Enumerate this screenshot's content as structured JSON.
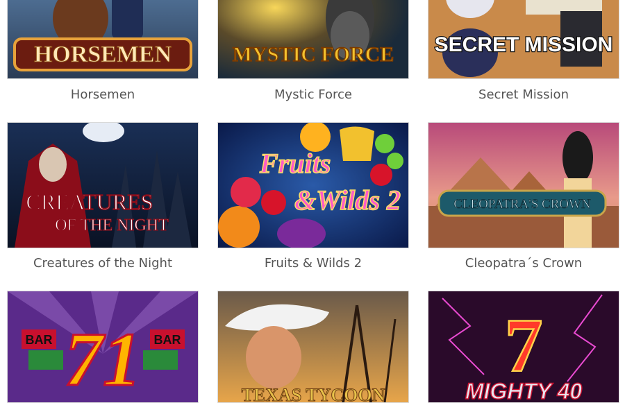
{
  "games": [
    {
      "id": "horsemen",
      "title": "Horsemen",
      "logo_text": "HORSEMEN",
      "icon": "horsemen-thumbnail",
      "accent": "#e8a23a"
    },
    {
      "id": "mystic-force",
      "title": "Mystic Force",
      "logo_text": "MYSTIC FORCE",
      "icon": "mystic-force-thumbnail",
      "accent": "#f2c12e"
    },
    {
      "id": "secret-mission",
      "title": "Secret Mission",
      "logo_text": "SECRET MISSION",
      "icon": "secret-mission-thumbnail",
      "accent": "#ffffff"
    },
    {
      "id": "creatures-night",
      "title": "Creatures of the Night",
      "logo_line1": "CREATURES",
      "logo_line2": "OF THE NIGHT",
      "icon": "creatures-thumbnail",
      "accent": "#c8102e"
    },
    {
      "id": "fruits-wilds-2",
      "title": "Fruits & Wilds 2",
      "logo_line1": "Fruits",
      "logo_line2": "&Wilds 2",
      "icon": "fruits-wilds-thumbnail",
      "accent": "#ff5ac8"
    },
    {
      "id": "cleopatras-crown",
      "title": "Cleopatra´s Crown",
      "logo_text": "CLEOPATRA'S CROWN",
      "icon": "cleopatra-thumbnail",
      "accent": "#7fb8c9"
    },
    {
      "id": "seventy-one",
      "title": "",
      "logo_text": "71",
      "bar_text": "BAR",
      "icon": "sevens-bars-thumbnail",
      "accent": "#ffb400"
    },
    {
      "id": "texas-tycoon",
      "title": "",
      "logo_text": "TEXAS TYCOON",
      "icon": "texas-tycoon-thumbnail",
      "accent": "#e7a54a"
    },
    {
      "id": "mighty-40",
      "title": "",
      "logo_text": "MIGHTY 40",
      "seven_text": "7",
      "icon": "mighty-40-thumbnail",
      "accent": "#ff3a2a"
    }
  ]
}
